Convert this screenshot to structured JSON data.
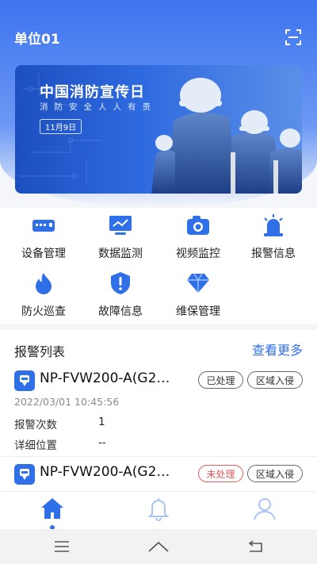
{
  "header": {
    "unit_title": "单位01",
    "scan_icon": "scan-icon"
  },
  "banner": {
    "title": "中国消防宣传日",
    "subtitle": "消防安全人人有责",
    "date_tag": "11月9日"
  },
  "menu": [
    {
      "label": "设备管理",
      "icon": "device-icon"
    },
    {
      "label": "数据监测",
      "icon": "monitor-icon"
    },
    {
      "label": "视频监控",
      "icon": "camera-icon"
    },
    {
      "label": "报警信息",
      "icon": "alarm-light-icon"
    },
    {
      "label": "防火巡查",
      "icon": "fire-icon"
    },
    {
      "label": "故障信息",
      "icon": "shield-alert-icon"
    },
    {
      "label": "维保管理",
      "icon": "diamond-icon"
    }
  ],
  "alarm_list": {
    "title": "报警列表",
    "more": "查看更多",
    "items": [
      {
        "name": "NP-FVW200-A(G2…",
        "status": "已处理",
        "type": "区域入侵",
        "time": "2022/03/01 10:45:56",
        "count_label": "报警次数",
        "count": "1",
        "location_label": "详细位置",
        "location": "--"
      },
      {
        "name": "NP-FVW200-A(G2…",
        "status": "未处理",
        "type": "区域入侵"
      }
    ]
  },
  "colors": {
    "accent": "#2f6fe8",
    "unhandled": "#e45b5b"
  },
  "tabbar": {
    "tabs": [
      "home-icon",
      "bell-icon",
      "user-icon"
    ],
    "active": 0
  },
  "system_nav": [
    "menu-icon",
    "home-outline-icon",
    "back-icon"
  ]
}
